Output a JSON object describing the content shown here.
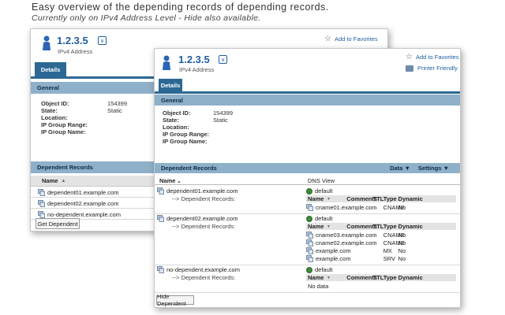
{
  "captions": {
    "line1": "Easy overview of the depending records of depending records.",
    "line2": "Currently only on IPv4 Address Level  - Hide also available."
  },
  "back": {
    "title": "1.2.3.5",
    "subtitle": "IPv4 Address",
    "favorites": "Add to Favorites",
    "tab": "Details",
    "general": "General",
    "props": [
      {
        "k": "Object ID:",
        "v": "154399"
      },
      {
        "k": "State:",
        "v": "Static"
      },
      {
        "k": "Location:",
        "v": ""
      },
      {
        "k": "IP Group Range:",
        "v": ""
      },
      {
        "k": "IP Group Name:",
        "v": ""
      }
    ],
    "dependent_records": "Dependent Records",
    "name_col": "Name",
    "rows": [
      "dependent01.example.com",
      "dependent02.example.com",
      "no-dependent.example.com"
    ],
    "button": "Get Dependent"
  },
  "front": {
    "title": "1.2.3.5",
    "subtitle": "IPv4 Address",
    "favorites": "Add to Favorites",
    "printer": "Printer Friendly",
    "tab": "Details",
    "general": "General",
    "props": [
      {
        "k": "Object ID:",
        "v": "154399"
      },
      {
        "k": "State:",
        "v": "Static"
      },
      {
        "k": "Location:",
        "v": ""
      },
      {
        "k": "IP Group Range:",
        "v": ""
      },
      {
        "k": "IP Group Name:",
        "v": ""
      }
    ],
    "dependent_records": "Dependent Records",
    "data_menu": "Data",
    "settings_menu": "Settings",
    "name_col": "Name",
    "dnsview_col": "DNS View",
    "dep_label": "--> Dependent Records:",
    "default_view": "default",
    "inner_cols": {
      "name": "Name",
      "comments": "Comments",
      "ttl": "TTL",
      "type": "Type",
      "dynamic": "Dynamic"
    },
    "groups": [
      {
        "name": "dependent01.example.com",
        "records": [
          {
            "name": "cname01.example.com",
            "type": "CNAME",
            "dynamic": "No"
          }
        ]
      },
      {
        "name": "dependent02.example.com",
        "records": [
          {
            "name": "cname03.example.com",
            "type": "CNAME",
            "dynamic": "No"
          },
          {
            "name": "cname02.example.com",
            "type": "CNAME",
            "dynamic": "No"
          },
          {
            "name": "example.com",
            "type": "MX",
            "dynamic": "No"
          },
          {
            "name": "example.com",
            "type": "SRV",
            "dynamic": "No"
          }
        ]
      },
      {
        "name": "no-dependent.example.com",
        "no_data": "No data"
      }
    ],
    "button": "Hide Dependent"
  }
}
